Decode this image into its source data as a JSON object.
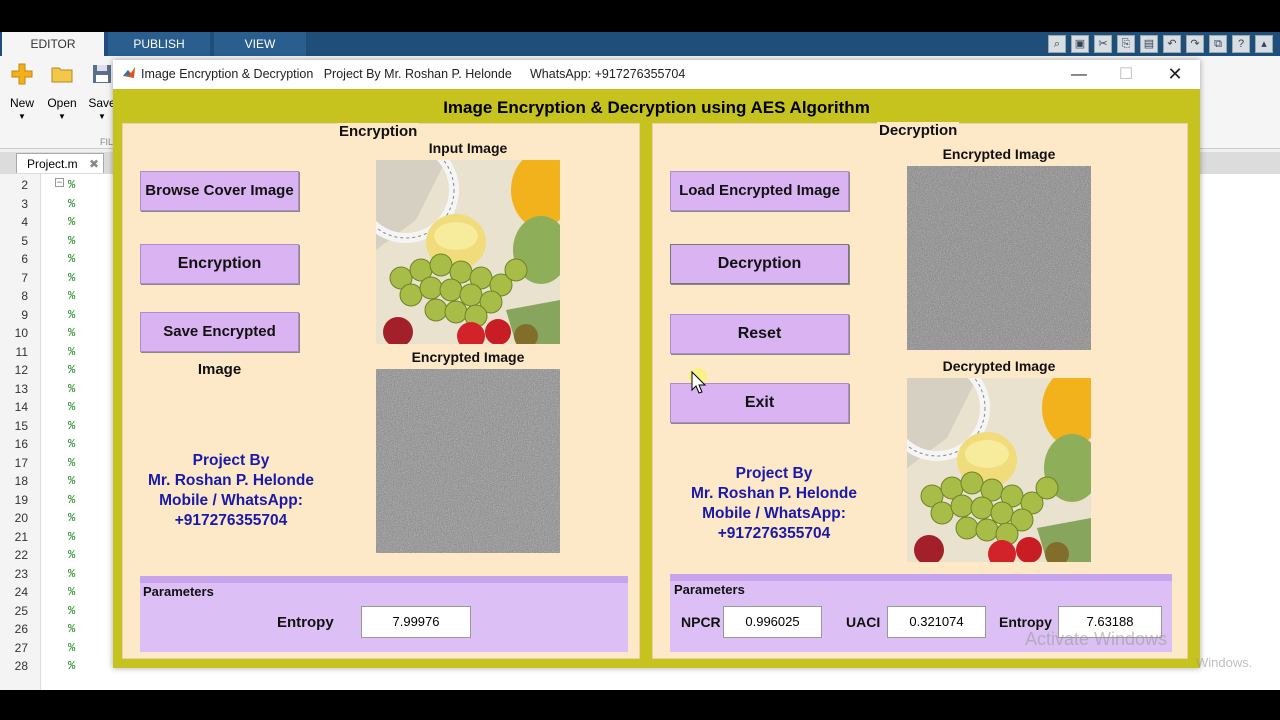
{
  "ribbon": {
    "tabs": [
      {
        "label": "EDITOR"
      },
      {
        "label": "PUBLISH"
      },
      {
        "label": "VIEW"
      }
    ],
    "buttons": [
      {
        "label": "New"
      },
      {
        "label": "Open"
      },
      {
        "label": "Save"
      }
    ],
    "group_label": "FIL"
  },
  "editor": {
    "file_tab": "Project.m",
    "line_numbers": [
      "2",
      "3",
      "4",
      "5",
      "6",
      "7",
      "8",
      "9",
      "10",
      "11",
      "12",
      "13",
      "14",
      "15",
      "16",
      "17",
      "18",
      "19",
      "20",
      "21",
      "22",
      "23",
      "24",
      "25",
      "26",
      "27",
      "28"
    ],
    "comment_char": "%"
  },
  "window": {
    "title": "Image Encryption & Decryption   Project By Mr. Roshan P. Helonde",
    "whatsapp": "WhatsApp: +917276355704"
  },
  "app": {
    "main_title": "Image Encryption & Decryption using AES Algorithm",
    "encryption": {
      "panel_title": "Encryption",
      "browse_button": "Browse Cover Image",
      "encrypt_button": "Encryption",
      "save_button": "Save Encrypted Image",
      "input_image_title": "Input Image",
      "encrypted_image_title": "Encrypted Image",
      "credit": [
        "Project By",
        "Mr. Roshan P. Helonde",
        "Mobile / WhatsApp:",
        "+917276355704"
      ],
      "params_title": "Parameters",
      "entropy_label": "Entropy",
      "entropy_value": "7.99976"
    },
    "decryption": {
      "panel_title": "Decryption",
      "load_button": "Load Encrypted Image",
      "decrypt_button": "Decryption",
      "reset_button": "Reset",
      "exit_button": "Exit",
      "encrypted_image_title": "Encrypted Image",
      "decrypted_image_title": "Decrypted Image",
      "credit": [
        "Project By",
        "Mr. Roshan P. Helonde",
        "Mobile / WhatsApp:",
        "+917276355704"
      ],
      "params_title": "Parameters",
      "npcr_label": "NPCR",
      "npcr_value": "0.996025",
      "uaci_label": "UACI",
      "uaci_value": "0.321074",
      "entropy_label": "Entropy",
      "entropy_value": "7.63188"
    }
  },
  "watermark": {
    "line1": "Activate Windows",
    "line2": "Windows."
  },
  "colors": {
    "figure_bg": "#c6c21e",
    "panel_bg": "#fde8c8",
    "button_bg": "#d9b3f2",
    "param_panel_bg": "#dcc0f5",
    "credit_text": "#1a1aa8",
    "ribbon_blue": "#1e4e79"
  }
}
